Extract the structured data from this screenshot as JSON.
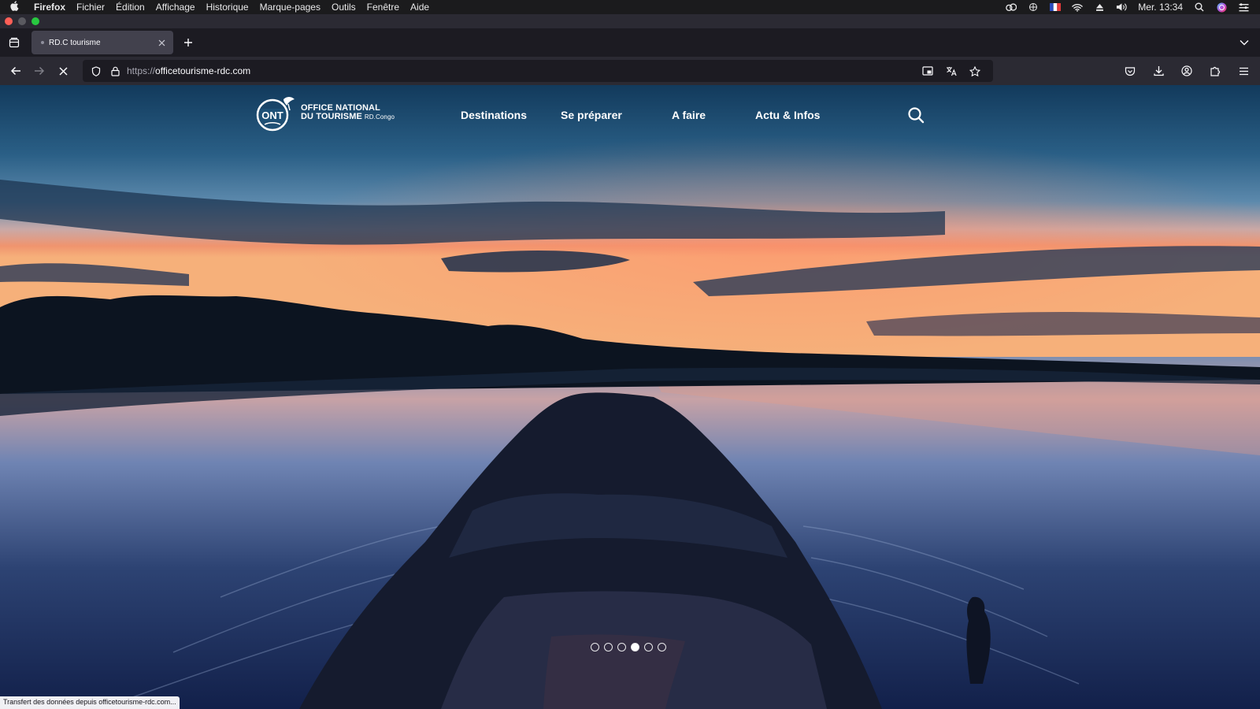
{
  "menubar": {
    "app_name": "Firefox",
    "items": [
      "Fichier",
      "Édition",
      "Affichage",
      "Historique",
      "Marque-pages",
      "Outils",
      "Fenêtre",
      "Aide"
    ],
    "clock": "Mer. 13:34"
  },
  "tab": {
    "title": "RD.C tourisme"
  },
  "urlbar": {
    "scheme": "https://",
    "host": "officetourisme-rdc.com"
  },
  "site": {
    "logo": {
      "line1": "OFFICE NATIONAL",
      "line2": "DU TOURISME",
      "suffix": "RD.Congo",
      "mark": "ONT"
    },
    "nav": [
      "Destinations",
      "Se préparer",
      "A faire",
      "Actu & Infos"
    ],
    "carousel": {
      "total": 6,
      "active_index": 3
    }
  },
  "status_text": "Transfert des données depuis officetourisme-rdc.com...",
  "colors": {
    "menubar_bg": "#1b1b1d",
    "toolbar_bg": "#2b2a33",
    "urlbar_bg": "#1c1b22"
  }
}
